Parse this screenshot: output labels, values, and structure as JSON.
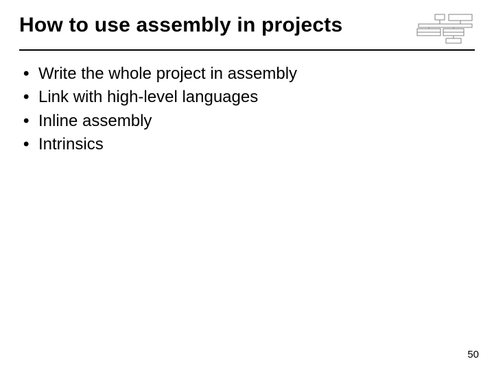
{
  "title": "How to use assembly in projects",
  "bullets": [
    "Write the whole project in assembly",
    "Link with high-level languages",
    "Inline assembly",
    "Intrinsics"
  ],
  "page_number": "50",
  "diagram_alt": "computer-architecture-block-diagram"
}
